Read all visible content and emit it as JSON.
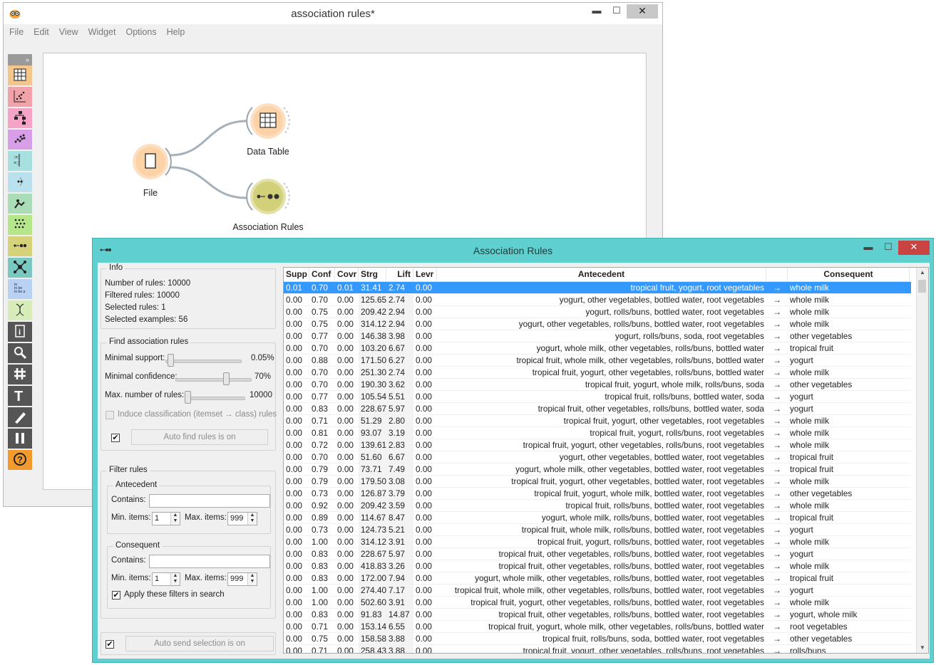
{
  "main_window": {
    "title": "association rules*",
    "menu": [
      "File",
      "Edit",
      "View",
      "Widget",
      "Options",
      "Help"
    ],
    "win_controls": {
      "minimize": "▬",
      "maximize": "☐",
      "close": "✕"
    },
    "toolbox": {
      "collapse": "»",
      "items": [
        {
          "name": "data-table-tool",
          "color": "#f5c68a"
        },
        {
          "name": "scatter-plot-tool",
          "color": "#f2a3a9"
        },
        {
          "name": "tree-tool",
          "color": "#f5a3c6"
        },
        {
          "name": "clustering-tool",
          "color": "#d99ee8"
        },
        {
          "name": "distance-tool",
          "color": "#a8e0e0"
        },
        {
          "name": "projection-tool",
          "color": "#b9e2ee"
        },
        {
          "name": "text-mining-tool",
          "color": "#a9dcb7"
        },
        {
          "name": "frequent-itemsets-tool",
          "color": "#b6e68a"
        },
        {
          "name": "association-rules-tool",
          "color": "#d6d27a"
        },
        {
          "name": "network-tool",
          "color": "#79c9c0"
        },
        {
          "name": "text-tool",
          "color": "#b9d2f3"
        },
        {
          "name": "bioinformatics-tool",
          "color": "#d7ecb8"
        },
        {
          "name": "info-tool",
          "color": "#555555"
        },
        {
          "name": "zoom-tool",
          "color": "#555555"
        },
        {
          "name": "grid-tool",
          "color": "#555555"
        },
        {
          "name": "text-annotation-tool",
          "color": "#555555"
        },
        {
          "name": "pen-tool",
          "color": "#555555"
        },
        {
          "name": "pause-tool",
          "color": "#555555"
        },
        {
          "name": "help-tool",
          "color": "#f29a2e"
        }
      ],
      "text_tool_label": "to\nto be\nto be a"
    },
    "nodes": {
      "file": "File",
      "data_table": "Data Table",
      "association_rules": "Association Rules"
    }
  },
  "ar_window": {
    "title": "Association Rules",
    "info": {
      "title": "Info",
      "number_of_rules": "Number of rules: 10000",
      "filtered_rules": "Filtered rules: 10000",
      "selected_rules": "Selected rules: 1",
      "selected_examples": "Selected examples: 56"
    },
    "find": {
      "title": "Find association rules",
      "min_support_label": "Minimal support:",
      "min_support_value": "0.05%",
      "min_support_level": 0.0,
      "min_confidence_label": "Minimal confidence:",
      "min_confidence_value": "70%",
      "min_confidence_level": 0.7,
      "max_rules_label": "Max. number of rules:",
      "max_rules_value": "10000",
      "max_rules_level": 0.05,
      "induce_label": "Induce classification (itemset → class) rules",
      "auto_find_label": "Auto find rules is on",
      "auto_find_checked": "✔"
    },
    "filter": {
      "title": "Filter rules",
      "antecedent_title": "Antecedent",
      "consequent_title": "Consequent",
      "contains_label": "Contains:",
      "min_items_label": "Min. items:",
      "max_items_label": "Max. items:",
      "ant_min": "1",
      "ant_max": "999",
      "con_min": "1",
      "con_max": "999",
      "apply_label": "Apply these filters in search",
      "apply_checked": "✔"
    },
    "auto_send_label": "Auto send selection is on",
    "auto_send_checked": "✔",
    "table": {
      "headers": [
        "Supp",
        "Conf",
        "Covr",
        "Strg",
        "Lift",
        "Levr",
        "Antecedent",
        "",
        "Consequent"
      ],
      "arrow": "→",
      "selected_row": 0,
      "rows": [
        [
          "0.01",
          "0.70",
          "0.01",
          "31.41",
          "2.74",
          "0.00",
          "tropical fruit, yogurt, root vegetables",
          "whole milk"
        ],
        [
          "0.00",
          "0.70",
          "0.00",
          "125.65",
          "2.74",
          "0.00",
          "yogurt, other vegetables, bottled water, root vegetables",
          "whole milk"
        ],
        [
          "0.00",
          "0.75",
          "0.00",
          "209.42",
          "2.94",
          "0.00",
          "yogurt, rolls/buns, bottled water, root vegetables",
          "whole milk"
        ],
        [
          "0.00",
          "0.75",
          "0.00",
          "314.12",
          "2.94",
          "0.00",
          "yogurt, other vegetables, rolls/buns, bottled water, root vegetables",
          "whole milk"
        ],
        [
          "0.00",
          "0.77",
          "0.00",
          "146.38",
          "3.98",
          "0.00",
          "yogurt, rolls/buns, soda, root vegetables",
          "other vegetables"
        ],
        [
          "0.00",
          "0.70",
          "0.00",
          "103.20",
          "6.67",
          "0.00",
          "yogurt, whole milk, other vegetables, rolls/buns, bottled water",
          "tropical fruit"
        ],
        [
          "0.00",
          "0.88",
          "0.00",
          "171.50",
          "6.27",
          "0.00",
          "tropical fruit, whole milk, other vegetables, rolls/buns, bottled water",
          "yogurt"
        ],
        [
          "0.00",
          "0.70",
          "0.00",
          "251.30",
          "2.74",
          "0.00",
          "tropical fruit, yogurt, other vegetables, rolls/buns, bottled water",
          "whole milk"
        ],
        [
          "0.00",
          "0.70",
          "0.00",
          "190.30",
          "3.62",
          "0.00",
          "tropical fruit, yogurt, whole milk, rolls/buns, soda",
          "other vegetables"
        ],
        [
          "0.00",
          "0.77",
          "0.00",
          "105.54",
          "5.51",
          "0.00",
          "tropical fruit, rolls/buns, bottled water, soda",
          "yogurt"
        ],
        [
          "0.00",
          "0.83",
          "0.00",
          "228.67",
          "5.97",
          "0.00",
          "tropical fruit, other vegetables, rolls/buns, bottled water, soda",
          "yogurt"
        ],
        [
          "0.00",
          "0.71",
          "0.00",
          "51.29",
          "2.80",
          "0.00",
          "tropical fruit, yogurt, other vegetables, root vegetables",
          "whole milk"
        ],
        [
          "0.00",
          "0.81",
          "0.00",
          "93.07",
          "3.19",
          "0.00",
          "tropical fruit, yogurt, rolls/buns, root vegetables",
          "whole milk"
        ],
        [
          "0.00",
          "0.72",
          "0.00",
          "139.61",
          "2.83",
          "0.00",
          "tropical fruit, yogurt, other vegetables, rolls/buns, root vegetables",
          "whole milk"
        ],
        [
          "0.00",
          "0.70",
          "0.00",
          "51.60",
          "6.67",
          "0.00",
          "yogurt, other vegetables, bottled water, root vegetables",
          "tropical fruit"
        ],
        [
          "0.00",
          "0.79",
          "0.00",
          "73.71",
          "7.49",
          "0.00",
          "yogurt, whole milk, other vegetables, bottled water, root vegetables",
          "tropical fruit"
        ],
        [
          "0.00",
          "0.79",
          "0.00",
          "179.50",
          "3.08",
          "0.00",
          "tropical fruit, yogurt, other vegetables, bottled water, root vegetables",
          "whole milk"
        ],
        [
          "0.00",
          "0.73",
          "0.00",
          "126.87",
          "3.79",
          "0.00",
          "tropical fruit, yogurt, whole milk, bottled water, root vegetables",
          "other vegetables"
        ],
        [
          "0.00",
          "0.92",
          "0.00",
          "209.42",
          "3.59",
          "0.00",
          "tropical fruit, rolls/buns, bottled water, root vegetables",
          "whole milk"
        ],
        [
          "0.00",
          "0.89",
          "0.00",
          "114.67",
          "8.47",
          "0.00",
          "yogurt, whole milk, rolls/buns, bottled water, root vegetables",
          "tropical fruit"
        ],
        [
          "0.00",
          "0.73",
          "0.00",
          "124.73",
          "5.21",
          "0.00",
          "tropical fruit, whole milk, rolls/buns, bottled water, root vegetables",
          "yogurt"
        ],
        [
          "0.00",
          "1.00",
          "0.00",
          "314.12",
          "3.91",
          "0.00",
          "tropical fruit, yogurt, rolls/buns, bottled water, root vegetables",
          "whole milk"
        ],
        [
          "0.00",
          "0.83",
          "0.00",
          "228.67",
          "5.97",
          "0.00",
          "tropical fruit, other vegetables, rolls/buns, bottled water, root vegetables",
          "yogurt"
        ],
        [
          "0.00",
          "0.83",
          "0.00",
          "418.83",
          "3.26",
          "0.00",
          "tropical fruit, other vegetables, rolls/buns, bottled water, root vegetables",
          "whole milk"
        ],
        [
          "0.00",
          "0.83",
          "0.00",
          "172.00",
          "7.94",
          "0.00",
          "yogurt, whole milk, other vegetables, rolls/buns, bottled water, root vegetables",
          "tropical fruit"
        ],
        [
          "0.00",
          "1.00",
          "0.00",
          "274.40",
          "7.17",
          "0.00",
          "tropical fruit, whole milk, other vegetables, rolls/buns, bottled water, root vegetables",
          "yogurt"
        ],
        [
          "0.00",
          "1.00",
          "0.00",
          "502.60",
          "3.91",
          "0.00",
          "tropical fruit, yogurt, other vegetables, rolls/buns, bottled water, root vegetables",
          "whole milk"
        ],
        [
          "0.00",
          "0.83",
          "0.00",
          "91.83",
          "14.87",
          "0.00",
          "tropical fruit, other vegetables, rolls/buns, bottled water, root vegetables",
          "yogurt, whole milk"
        ],
        [
          "0.00",
          "0.71",
          "0.00",
          "153.14",
          "6.55",
          "0.00",
          "tropical fruit, yogurt, whole milk, other vegetables, rolls/buns, bottled water",
          "root vegetables"
        ],
        [
          "0.00",
          "0.75",
          "0.00",
          "158.58",
          "3.88",
          "0.00",
          "tropical fruit, rolls/buns, soda, bottled water, root vegetables",
          "other vegetables"
        ],
        [
          "0.00",
          "0.71",
          "0.00",
          "258.43",
          "3.88",
          "0.00",
          "tropical fruit, yogurt, other vegetables, rolls/buns, root vegetables",
          "rolls/buns"
        ]
      ]
    }
  }
}
